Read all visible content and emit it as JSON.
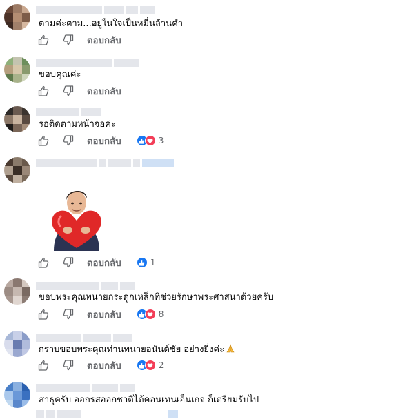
{
  "comments": [
    {
      "text": "ตามค่ะตาม...อยู่ในใจเป็นหมื่นล้านคำ",
      "reply_label": "ตอบกลับ",
      "reaction_count": "",
      "avatar_colors": [
        "#6b4a3a",
        "#9c7a64",
        "#c9a88f",
        "#4d3328",
        "#b38d72",
        "#7d5c48",
        "#3d2a22",
        "#a0806a",
        "#d6b8a0"
      ]
    },
    {
      "text": "ขอบคุณค่ะ",
      "reply_label": "ตอบกลับ",
      "reaction_count": "",
      "avatar_colors": [
        "#8fb07a",
        "#c4c4b0",
        "#6d8f5c",
        "#b59f7e",
        "#d6c7aa",
        "#8a9b6e",
        "#5f7a4c",
        "#a8b28a",
        "#cfd6bb"
      ]
    },
    {
      "text": "รอติดตามหน้าจอค่ะ",
      "reply_label": "ตอบกลับ",
      "reaction_count": "3",
      "avatar_colors": [
        "#2e2a28",
        "#6a5a50",
        "#3b332e",
        "#8c7868",
        "#c9b4a0",
        "#5a4a40",
        "#1f1c1a",
        "#7a6658",
        "#a48c78"
      ]
    },
    {
      "text": "",
      "reply_label": "ตอบกลับ",
      "reaction_count": "1",
      "avatar_colors": [
        "#4a3a30",
        "#8a7a6a",
        "#6a5a4c",
        "#b0a090",
        "#3a2e26",
        "#9a8878",
        "#5c4c40",
        "#c0b0a0",
        "#7a6a5a"
      ]
    },
    {
      "text": "ขอบพระคุณทนายกระดูกเหล็กที่ช่วยรักษาพระศาสนาด้วยครับ",
      "reply_label": "ตอบกลับ",
      "reaction_count": "8",
      "avatar_colors": [
        "#b8a8a0",
        "#8a7870",
        "#d4c8c0",
        "#9c8c84",
        "#c6b8b0",
        "#7a6a62",
        "#a89890",
        "#e0d6d0",
        "#8c7c74"
      ]
    },
    {
      "text": "กราบขอบพระคุณท่านทนายอนันต์ชัย อย่างยิ่งค่ะ",
      "reply_label": "ตอบกลับ",
      "reaction_count": "2",
      "avatar_colors": [
        "#a8b8d8",
        "#c8d0e8",
        "#8a9cc8",
        "#d8dcec",
        "#6a7cb0",
        "#b0bcdc",
        "#e0e4f0",
        "#9aa8d0",
        "#c0c8e4"
      ]
    },
    {
      "text": "สาธุครับ ออกรสออกชาติได้คอนเทนเอ็นเกจ ก็เตรียมรับไป",
      "reply_label": "ตอบกลับ",
      "reaction_count": "",
      "avatar_colors": [
        "#4a80c8",
        "#8ab0e0",
        "#2a60b0",
        "#aac8ec",
        "#6a98d8",
        "#3a70c0",
        "#c0d8f0",
        "#5a88cc",
        "#9abce8"
      ]
    }
  ],
  "icons": {
    "like": "thumbs-up-icon",
    "dislike": "thumbs-down-icon",
    "pray": "folded-hands-emoji",
    "sticker": "man-hugging-heart-sticker"
  },
  "colors": {
    "meta_gray": "#65676b",
    "like_blue": "#1877f2",
    "love_red": "#f33e58",
    "placeholder": "#e4e6eb"
  }
}
